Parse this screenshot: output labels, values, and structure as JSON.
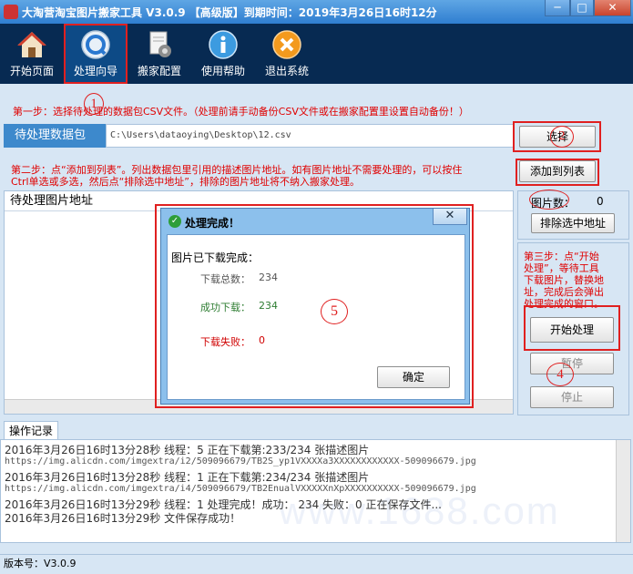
{
  "window": {
    "title": "大淘营淘宝图片搬家工具 V3.0.9 【高级版】到期时间：2019年3月26日16时12分",
    "minimize": "─",
    "maximize": "□",
    "close": "✕"
  },
  "toolbar": {
    "items": [
      {
        "label": "开始页面",
        "icon": "home-icon"
      },
      {
        "label": "处理向导",
        "icon": "wizard-icon"
      },
      {
        "label": "搬家配置",
        "icon": "settings-document-icon"
      },
      {
        "label": "使用帮助",
        "icon": "info-icon"
      },
      {
        "label": "退出系统",
        "icon": "exit-icon"
      }
    ]
  },
  "steps": {
    "step1": "第一步：选择待处理的数据包CSV文件。（处理前请手动备份CSV文件或在搬家配置里设置自动备份！）",
    "step2_line1": "第二步：点“添加到列表”。列出数据包里引用的描述图片地址。如有图片地址不需要处理的，可以按住",
    "step2_line2": "Ctrl单选或多选，然后点“排除选中地址”，排除的图片地址将不纳入搬家处理。",
    "step3": [
      "第三步：点“开始",
      "处理”，等待工具",
      "下载图片，替换地",
      "址，完成后会弹出",
      "处理完成的窗口。"
    ]
  },
  "package": {
    "label": "待处理数据包",
    "path": "C:\\Users\\dataoying\\Desktop\\12.csv"
  },
  "buttons": {
    "select": "选择",
    "add_to_list": "添加到列表",
    "exclude": "排除选中地址",
    "start": "开始处理",
    "pause": "暂停",
    "stop": "停止"
  },
  "list": {
    "header": "待处理图片地址",
    "count_label": "图片数：",
    "count_value": "0"
  },
  "annotations": [
    "1",
    "2",
    "3",
    "4",
    "5"
  ],
  "dialog": {
    "title": "处理完成！",
    "close": "✕",
    "heading": "图片已下载完成：",
    "total_label": "下载总数：",
    "total_value": "234",
    "success_label": "成功下载：",
    "success_value": "234",
    "fail_label": "下载失败：",
    "fail_value": "0",
    "ok": "确定"
  },
  "log": {
    "tab": "操作记录",
    "lines": [
      "2016年3月26日16时13分28秒 线程：5  正在下载第:233/234 张描述图片",
      "https://img.alicdn.com/imgextra/i2/509096679/TB2S_yp1VXXXXa3XXXXXXXXXXXX-509096679.jpg",
      "2016年3月26日16时13分28秒 线程：1  正在下载第:234/234 张描述图片",
      "https://img.alicdn.com/imgextra/i4/509096679/TB2EnualVXXXXXnXpXXXXXXXXXX-509096679.jpg",
      "2016年3月26日16时13分29秒  线程：1 处理完成！成功： 234 失败：0 正在保存文件...",
      "2016年3月26日16时13分29秒  文件保存成功！"
    ],
    "watermark": "www.1688.com"
  },
  "status": {
    "version": "版本号：V3.0.9"
  },
  "colors": {
    "toolbar_bg": "#072a52",
    "accent": "#3d89cc",
    "annotation": "#e02020",
    "success_green": "#2e7d32"
  }
}
